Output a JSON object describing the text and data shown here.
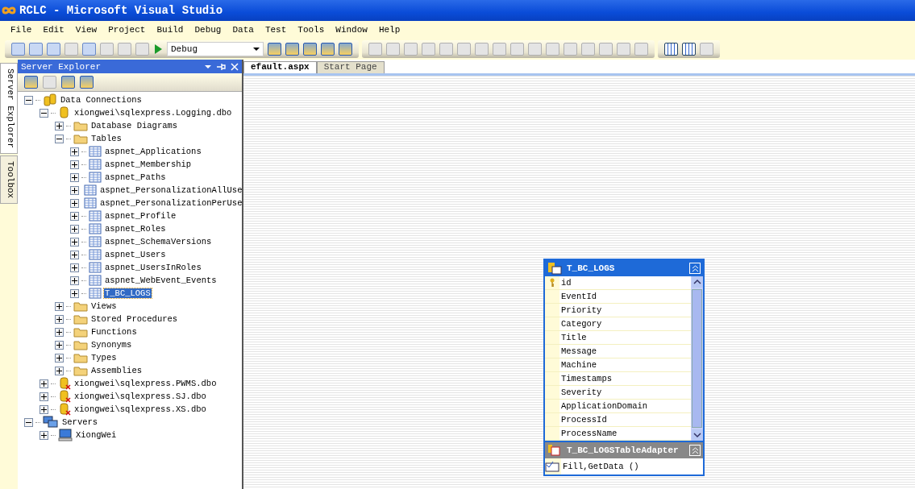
{
  "window": {
    "title": "RCLC - Microsoft Visual Studio"
  },
  "menu": [
    {
      "label": "File"
    },
    {
      "label": "Edit"
    },
    {
      "label": "View"
    },
    {
      "label": "Project"
    },
    {
      "label": "Build"
    },
    {
      "label": "Debug"
    },
    {
      "label": "Data"
    },
    {
      "label": "Test"
    },
    {
      "label": "Tools"
    },
    {
      "label": "Window"
    },
    {
      "label": "Help"
    }
  ],
  "toolbar": {
    "configuration": "Debug"
  },
  "side_tabs": [
    {
      "label": "Server Explorer",
      "selected": true
    },
    {
      "label": "Toolbox",
      "selected": false
    }
  ],
  "server_explorer": {
    "title": "Server Explorer",
    "tree": [
      {
        "label": "Data Connections",
        "kind": "connections",
        "expanded": true,
        "selected": false,
        "children": [
          {
            "label": "xiongwei\\sqlexpress.Logging.dbo",
            "kind": "database",
            "expanded": true,
            "selected": false,
            "children": [
              {
                "label": "Database Diagrams",
                "kind": "folder",
                "expanded": false,
                "selected": false
              },
              {
                "label": "Tables",
                "kind": "folder",
                "expanded": true,
                "selected": false,
                "children": [
                  {
                    "label": "aspnet_Applications",
                    "kind": "table",
                    "expanded": false,
                    "selected": false
                  },
                  {
                    "label": "aspnet_Membership",
                    "kind": "table",
                    "expanded": false,
                    "selected": false
                  },
                  {
                    "label": "aspnet_Paths",
                    "kind": "table",
                    "expanded": false,
                    "selected": false
                  },
                  {
                    "label": "aspnet_PersonalizationAllUse",
                    "kind": "table",
                    "expanded": false,
                    "selected": false
                  },
                  {
                    "label": "aspnet_PersonalizationPerUse",
                    "kind": "table",
                    "expanded": false,
                    "selected": false
                  },
                  {
                    "label": "aspnet_Profile",
                    "kind": "table",
                    "expanded": false,
                    "selected": false
                  },
                  {
                    "label": "aspnet_Roles",
                    "kind": "table",
                    "expanded": false,
                    "selected": false
                  },
                  {
                    "label": "aspnet_SchemaVersions",
                    "kind": "table",
                    "expanded": false,
                    "selected": false
                  },
                  {
                    "label": "aspnet_Users",
                    "kind": "table",
                    "expanded": false,
                    "selected": false
                  },
                  {
                    "label": "aspnet_UsersInRoles",
                    "kind": "table",
                    "expanded": false,
                    "selected": false
                  },
                  {
                    "label": "aspnet_WebEvent_Events",
                    "kind": "table",
                    "expanded": false,
                    "selected": false
                  },
                  {
                    "label": "T_BC_LOGS",
                    "kind": "table",
                    "expanded": false,
                    "selected": true
                  }
                ]
              },
              {
                "label": "Views",
                "kind": "folder",
                "expanded": false,
                "selected": false
              },
              {
                "label": "Stored Procedures",
                "kind": "folder",
                "expanded": false,
                "selected": false
              },
              {
                "label": "Functions",
                "kind": "folder",
                "expanded": false,
                "selected": false
              },
              {
                "label": "Synonyms",
                "kind": "folder",
                "expanded": false,
                "selected": false
              },
              {
                "label": "Types",
                "kind": "folder",
                "expanded": false,
                "selected": false
              },
              {
                "label": "Assemblies",
                "kind": "folder",
                "expanded": false,
                "selected": false
              }
            ]
          },
          {
            "label": "xiongwei\\sqlexpress.PWMS.dbo",
            "kind": "broken-database",
            "expanded": false,
            "selected": false
          },
          {
            "label": "xiongwei\\sqlexpress.SJ.dbo",
            "kind": "broken-database",
            "expanded": false,
            "selected": false
          },
          {
            "label": "xiongwei\\sqlexpress.XS.dbo",
            "kind": "broken-database",
            "expanded": false,
            "selected": false
          }
        ]
      },
      {
        "label": "Servers",
        "kind": "servers",
        "expanded": true,
        "selected": false,
        "children": [
          {
            "label": "XiongWei",
            "kind": "computer",
            "expanded": false,
            "selected": false
          }
        ]
      }
    ]
  },
  "doc_tabs": [
    {
      "label": "efault.aspx",
      "selected": true
    },
    {
      "label": "Start Page",
      "selected": false
    }
  ],
  "designer": {
    "table": {
      "title": "T_BC_LOGS",
      "expanded": true,
      "columns": [
        {
          "name": "id",
          "primary_key": true
        },
        {
          "name": "EventId",
          "primary_key": false
        },
        {
          "name": "Priority",
          "primary_key": false
        },
        {
          "name": "Category",
          "primary_key": false
        },
        {
          "name": "Title",
          "primary_key": false
        },
        {
          "name": "Message",
          "primary_key": false
        },
        {
          "name": "Machine",
          "primary_key": false
        },
        {
          "name": "Timestamps",
          "primary_key": false
        },
        {
          "name": "Severity",
          "primary_key": false
        },
        {
          "name": "ApplicationDomain",
          "primary_key": false
        },
        {
          "name": "ProcessId",
          "primary_key": false
        },
        {
          "name": "ProcessName",
          "primary_key": false
        }
      ]
    },
    "adapter": {
      "title": "T_BC_LOGSTableAdapter",
      "expanded": true,
      "methods": [
        "Fill,GetData ()"
      ]
    }
  }
}
